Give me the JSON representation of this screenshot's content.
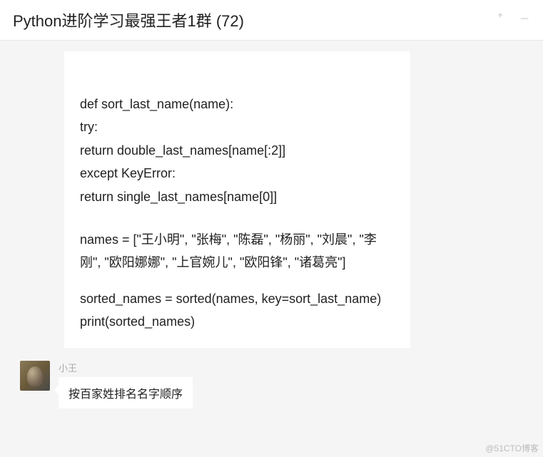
{
  "header": {
    "title": "Python进阶学习最强王者1群 (72)"
  },
  "code": {
    "cutoff_fragment": "— — · · — ·",
    "lines": [
      "def sort_last_name(name):",
      "try:",
      "return double_last_names[name[:2]]",
      "except KeyError:",
      "return single_last_names[name[0]]"
    ],
    "names_block": "names = [\"王小明\", \"张梅\", \"陈磊\", \"杨丽\", \"刘晨\", \"李刚\", \"欧阳娜娜\", \"上官婉儿\", \"欧阳锋\", \"诸葛亮\"]",
    "sorted_block": "sorted_names = sorted(names, key=sort_last_name)",
    "print_line": "print(sorted_names)"
  },
  "message": {
    "sender": "小王",
    "text": "按百家姓排名名字顺序"
  },
  "watermark": "@51CTO博客"
}
